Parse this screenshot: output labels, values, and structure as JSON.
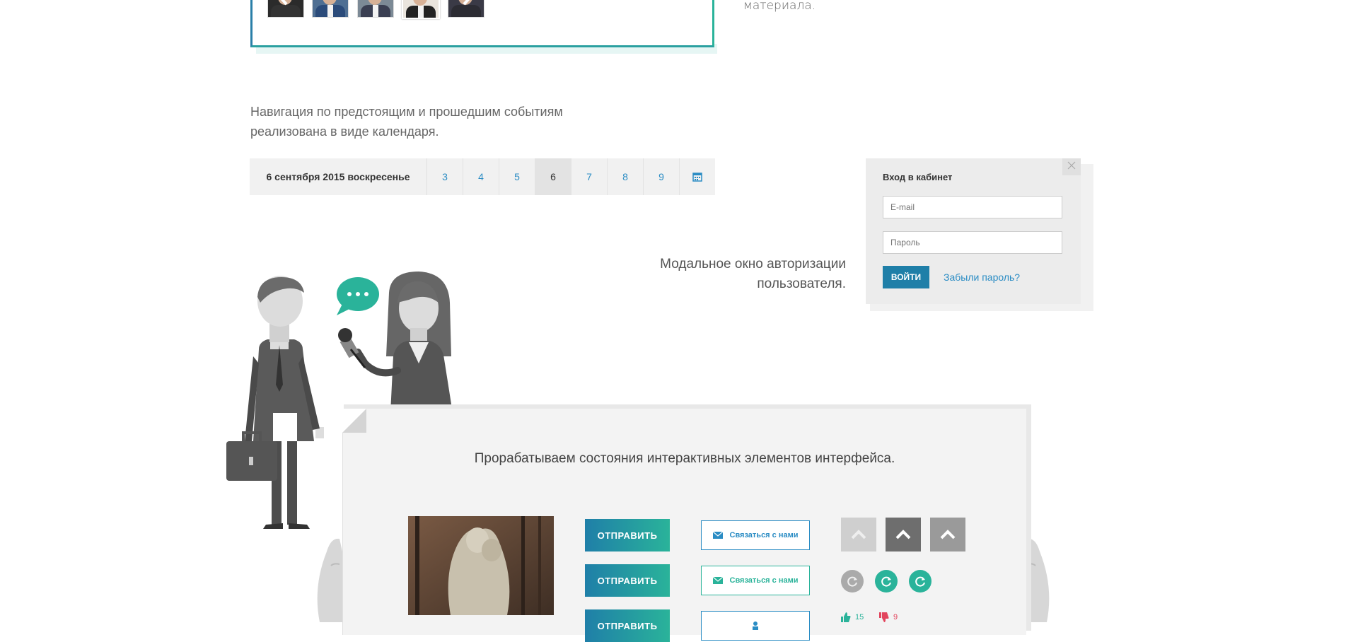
{
  "gallery": {
    "prev_icon": "chevron-left-icon",
    "next_icon": "chevron-right-icon",
    "side_text": "материала."
  },
  "events_paragraph": {
    "line1": "Навигация по предстоящим и прошедшим событиям",
    "line2": "реализована в виде календаря."
  },
  "calendar": {
    "current_date": "6 сентября 2015 воскресенье",
    "days": [
      "3",
      "4",
      "5",
      "6",
      "7",
      "8",
      "9"
    ],
    "active_day": "6",
    "icon": "calendar-icon"
  },
  "login": {
    "title": "Вход в кабинет",
    "email_placeholder": "E-mail",
    "password_placeholder": "Пароль",
    "submit": "ВОЙТИ",
    "forgot": "Забыли пароль?",
    "close_icon": "close-icon",
    "caption_line1": "Модальное окно авторизации",
    "caption_line2": "пользователя."
  },
  "states_card": {
    "title": "Прорабатываем состояния интерактивных элементов интерфейса.",
    "send_label": "ОТПРАВИТЬ",
    "contact_label": "Связаться с нами",
    "votes_up": "15",
    "votes_down": "9"
  },
  "colors": {
    "accent_blue": "#1f7fa8",
    "accent_green": "#2ab39a",
    "link_blue": "#2a8cc4",
    "vote_down": "#e2445c"
  }
}
